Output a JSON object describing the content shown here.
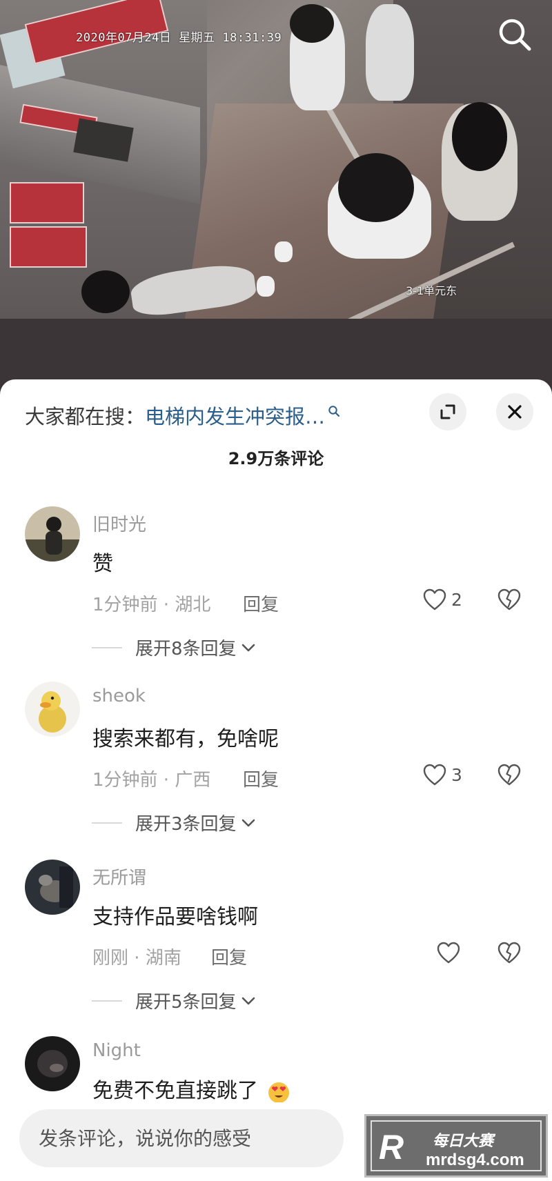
{
  "video": {
    "timestamp": "2020年07月24日 星期五 18:31:39",
    "camera_label": "3-1单元东"
  },
  "sheet": {
    "search_prefix": "大家都在搜：",
    "search_query": "电梯内发生冲突报…",
    "comment_count": "2.9万条评论"
  },
  "comments": [
    {
      "username": "旧时光",
      "text": "赞",
      "time": "1分钟前",
      "location": "湖北",
      "reply_label": "回复",
      "likes": "2",
      "expand_label": "展开8条回复"
    },
    {
      "username": "sheok",
      "text": "搜索来都有，免啥呢",
      "time": "1分钟前",
      "location": "广西",
      "reply_label": "回复",
      "likes": "3",
      "expand_label": "展开3条回复"
    },
    {
      "username": "无所谓",
      "text": "支持作品要啥钱啊",
      "time": "刚刚",
      "location": "湖南",
      "reply_label": "回复",
      "likes": "",
      "expand_label": "展开5条回复"
    },
    {
      "username": "Night",
      "text": "免费不免直接跳了"
    }
  ],
  "input": {
    "placeholder": "发条评论，说说你的感受"
  },
  "watermark": {
    "logo": "R",
    "title": "每日大赛",
    "url": "mrdsg4.com"
  },
  "meta_separator": " · ",
  "colors": {
    "link_blue": "#2a5e8c",
    "sheet_bg": "#ffffff",
    "backdrop": "#3b3537"
  },
  "icons": [
    "search-icon",
    "expand-icon",
    "close-icon",
    "heart-icon",
    "dislike-heart-icon",
    "chevron-down-icon",
    "heart-eyes-emoji"
  ]
}
